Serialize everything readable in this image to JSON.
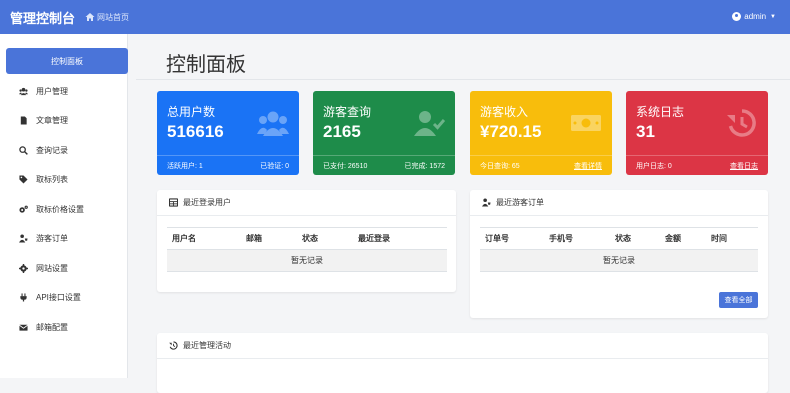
{
  "header": {
    "brand": "管理控制台",
    "home_link": "网站首页",
    "user": "admin"
  },
  "sidebar": {
    "items": [
      {
        "label": "控制面板",
        "icon": "dashboard-icon",
        "active": true
      },
      {
        "label": "用户管理",
        "icon": "users-icon"
      },
      {
        "label": "文章管理",
        "icon": "file-icon"
      },
      {
        "label": "查询记录",
        "icon": "search-icon"
      },
      {
        "label": "取标列表",
        "icon": "tag-icon"
      },
      {
        "label": "取标价格设置",
        "icon": "cogs-icon"
      },
      {
        "label": "游客订单",
        "icon": "user-cart-icon"
      },
      {
        "label": "网站设置",
        "icon": "gear-icon"
      },
      {
        "label": "API接口设置",
        "icon": "plug-icon"
      },
      {
        "label": "邮箱配置",
        "icon": "envelope-icon"
      }
    ]
  },
  "page_title": "控制面板",
  "stats": [
    {
      "label": "总用户数",
      "value": "516616",
      "foot_left": "活跃用户: 1",
      "foot_right": "已验证: 0",
      "icon": "users-icon",
      "color": "#1a73f5"
    },
    {
      "label": "游客查询",
      "value": "2165",
      "foot_left": "已支付: 26510",
      "foot_right": "已完成: 1572",
      "icon": "user-check-icon",
      "color": "#1e8c4a"
    },
    {
      "label": "游客收入",
      "value": "¥720.15",
      "foot_left": "今日查询: 65",
      "foot_right": "查看详情",
      "icon": "money-bill-icon",
      "color": "#f8bd0c"
    },
    {
      "label": "系统日志",
      "value": "31",
      "foot_left": "用户日志: 0",
      "foot_right": "查看日志",
      "icon": "history-icon",
      "color": "#dc3545"
    }
  ],
  "recent_users": {
    "title": "最近登录用户",
    "columns": [
      "用户名",
      "邮箱",
      "状态",
      "最近登录"
    ],
    "empty": "暂无记录"
  },
  "recent_orders": {
    "title": "最近游客订单",
    "columns": [
      "订单号",
      "手机号",
      "状态",
      "金额",
      "时间"
    ],
    "empty": "暂无记录",
    "view_all": "查看全部"
  },
  "recent_activity": {
    "title": "最近管理活动"
  }
}
